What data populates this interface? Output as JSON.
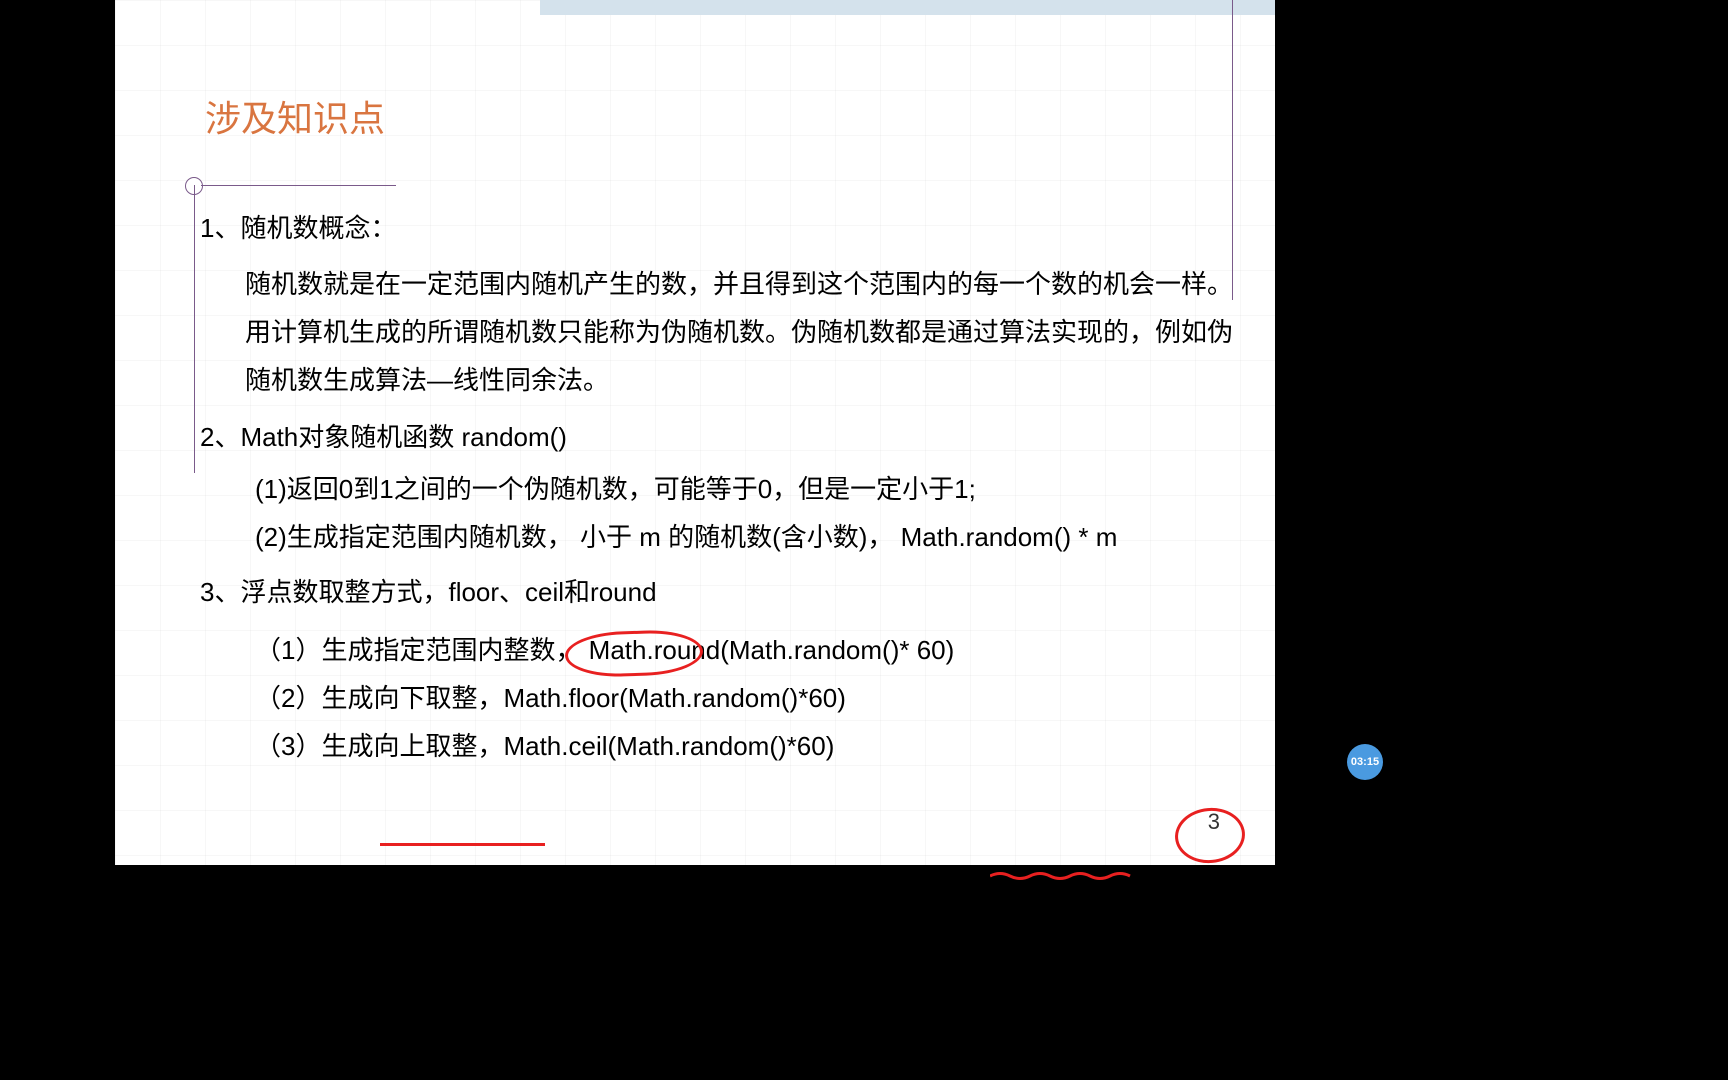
{
  "slide": {
    "title": "涉及知识点",
    "page_number": "3",
    "point1": {
      "num": "1、",
      "label": "随机数概念：",
      "text": "随机数就是在一定范围内随机产生的数，并且得到这个范围内的每一个数的机会一样。用计算机生成的所谓随机数只能称为伪随机数。伪随机数都是通过算法实现的，例如伪随机数生成算法—线性同余法。"
    },
    "point2": {
      "num": "2、",
      "label": "Math对象随机函数 random()",
      "sub1": "(1)返回0到1之间的一个伪随机数，可能等于0，但是一定小于1;",
      "sub2": "(2)生成指定范围内随机数， 小于 m 的随机数(含小数)， Math.random() * m"
    },
    "point3": {
      "num": "3、",
      "label": "浮点数取整方式，floor、ceil和round",
      "sub1": "（1）生成指定范围内整数， Math.round(Math.random()* 60)",
      "sub2": "（2）生成向下取整，Math.floor(Math.random()*60)",
      "sub3": "（3）生成向上取整，Math.ceil(Math.random()*60)"
    }
  },
  "timestamp": "03:15"
}
